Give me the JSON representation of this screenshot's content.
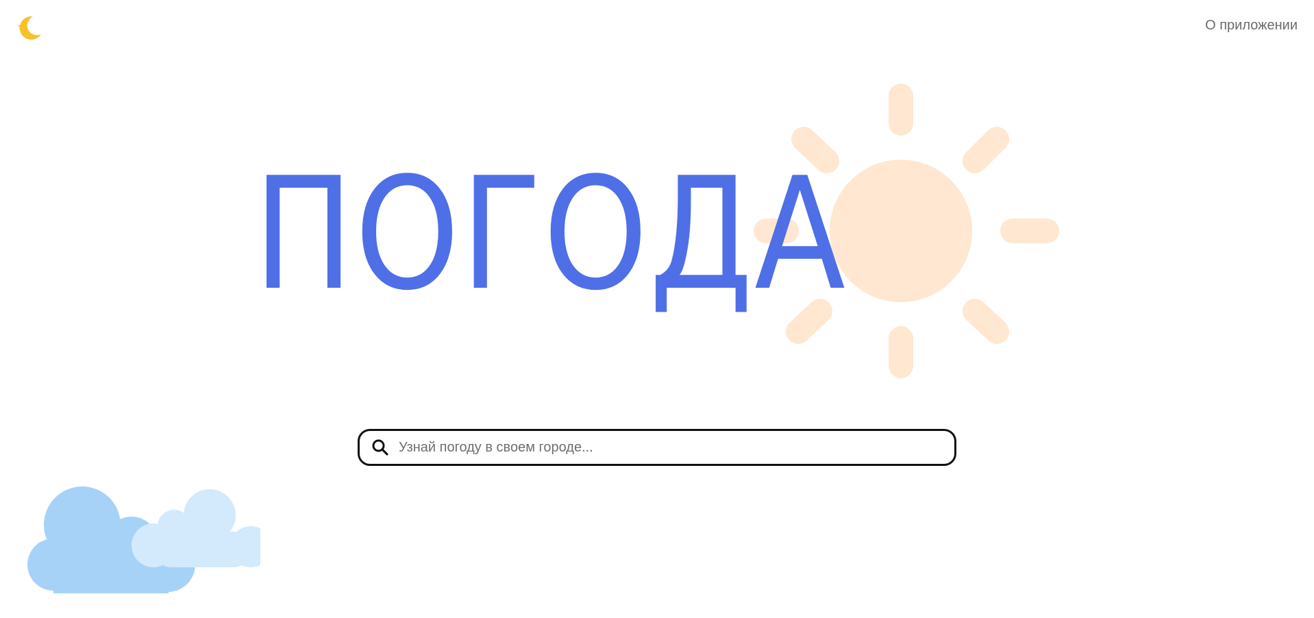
{
  "header": {
    "theme_toggle_icon": "moon-stars-icon",
    "about_label": "О приложении"
  },
  "hero": {
    "title": "ПОГОДА",
    "sun_icon": "sun-icon"
  },
  "search": {
    "icon": "search-icon",
    "placeholder": "Узнай погоду в своем городе...",
    "value": ""
  },
  "decoration": {
    "clouds_icon": "clouds-icon"
  },
  "colors": {
    "title": "#4f6fe6",
    "sun": "#ffe7d1",
    "cloud_back": "#a7d2f7",
    "cloud_front": "#d3e9fc",
    "moon": "#f8c12c",
    "link": "#6b6b6b",
    "search_border": "#111111"
  }
}
